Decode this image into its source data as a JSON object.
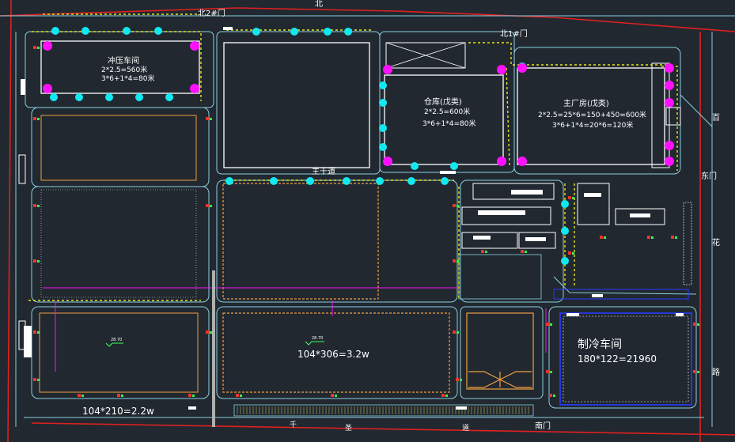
{
  "colors": {
    "background": "#212830",
    "road_edge": "#8cd1e0",
    "boundary": "#e02020",
    "building_outline": "#ffffff",
    "fence": "#e6e61a",
    "lamp_cyan": "#12e8f0",
    "lamp_magenta": "#ff10ff",
    "hatch_orange": "#f0a040",
    "refrigeration_outline": "#2a3aff"
  },
  "gates": {
    "north2": "北2#门",
    "north1": "北1#门",
    "east": "东门",
    "south": "南门"
  },
  "roads": {
    "main_road": "主干道",
    "north_road_char": "北",
    "east_road_chars": [
      "百",
      "花",
      "路"
    ],
    "south_road_chars": [
      "千",
      "圣",
      "道"
    ]
  },
  "buildings": {
    "stamping": {
      "name": "冲压车间",
      "line1": "2*2.5=560米",
      "line2": "3*6+1*4=80米"
    },
    "warehouse": {
      "name": "仓库(戊类)",
      "line1": "2*2.5=600米",
      "line2": "3*6+1*4=80米"
    },
    "main_plant": {
      "name": "主厂房(戊类)",
      "line1": "2*2.5=25*6=150+450=600米",
      "line2": "3*6+1*4=20*6=120米"
    },
    "refrigeration": {
      "name": "制冷车间",
      "dims": "180*122=21960"
    },
    "workshop_center": {
      "dims": "104*306=3.2w",
      "elev": "28.70"
    },
    "workshop_left": {
      "dims": "104*210=2.2w",
      "elev": "28.70"
    }
  },
  "icons": [
    "lamp-icon",
    "fire-hydrant-icon",
    "elevation-marker-icon",
    "hatch-cross-icon"
  ]
}
